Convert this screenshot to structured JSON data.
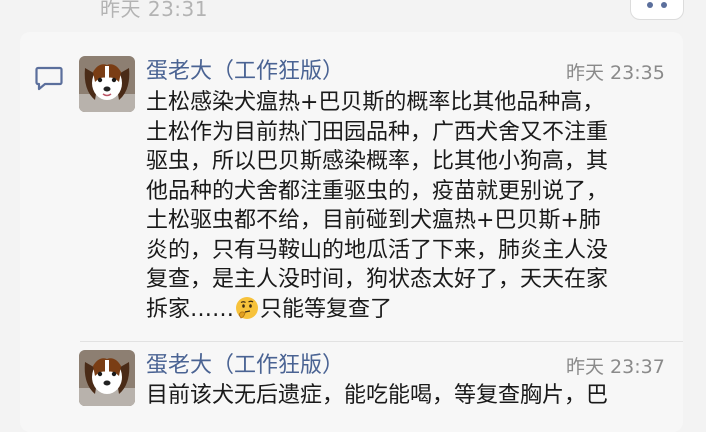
{
  "header": {
    "prev_time": "昨天 23:31"
  },
  "comments": [
    {
      "author": "蛋老大（工作狂版）",
      "time": "昨天 23:35",
      "lines": [
        "土松感染犬瘟热+巴贝斯的概率比其他品种高，",
        "土松作为目前热门田园品种，广西犬舍又不注重",
        "驱虫，所以巴贝斯感染概率，比其他小狗高，其",
        "他品种的犬舍都注重驱虫的，疫苗就更别说了，",
        "土松驱虫都不给，目前碰到犬瘟热+巴贝斯+肺",
        "炎的，只有马鞍山的地瓜活了下来，肺炎主人没",
        "复查，是主人没时间，狗状态太好了，天天在家"
      ],
      "last_line_before_emoji": "拆家……",
      "emoji": "thinking-face-emoji",
      "last_line_after_emoji": "只能等复查了"
    },
    {
      "author": "蛋老大（工作狂版）",
      "time": "昨天 23:37",
      "partial_line": "目前该犬无后遗症，能吃能喝，等复查胸片，巴"
    }
  ],
  "icons": {
    "comment": "comment-bubble-icon",
    "more": "more-dots-icon",
    "avatar": "dog-avatar"
  },
  "colors": {
    "name": "#4a6393",
    "time": "#8a8a8a",
    "text": "#1a1a1a",
    "background": "#f3f3f3"
  }
}
